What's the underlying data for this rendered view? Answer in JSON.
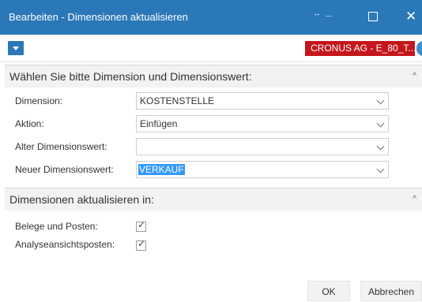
{
  "window": {
    "title": "Bearbeiten - Dimensionen aktualisieren",
    "expand_glyph": "↔",
    "close_glyph": "✕"
  },
  "toolbar": {
    "menu_icon": "dropdown-arrow-icon",
    "company": "CRONUS AG - E_80_T...",
    "company_color": "#c4161c",
    "accent_color": "#2b78b9"
  },
  "section1": {
    "header": "Wählen Sie bitte Dimension und Dimensionswert:",
    "collapse_glyph": "^",
    "fields": [
      {
        "label": "Dimension:",
        "value": "KOSTENSTELLE"
      },
      {
        "label": "Aktion:",
        "value": "Einfügen"
      },
      {
        "label": "Alter Dimensionswert:",
        "value": ""
      },
      {
        "label": "Neuer Dimensionswert:",
        "value": "VERKAUF"
      }
    ]
  },
  "section2": {
    "header": "Dimensionen aktualisieren in:",
    "collapse_glyph": "^",
    "checkboxes": [
      {
        "label": "Belege und Posten:",
        "checked": true,
        "mark": "✓"
      },
      {
        "label": "Analyseansichtsposten:",
        "checked": true,
        "mark": "✓"
      }
    ]
  },
  "buttons": {
    "ok": "OK",
    "cancel": "Abbrechen"
  }
}
